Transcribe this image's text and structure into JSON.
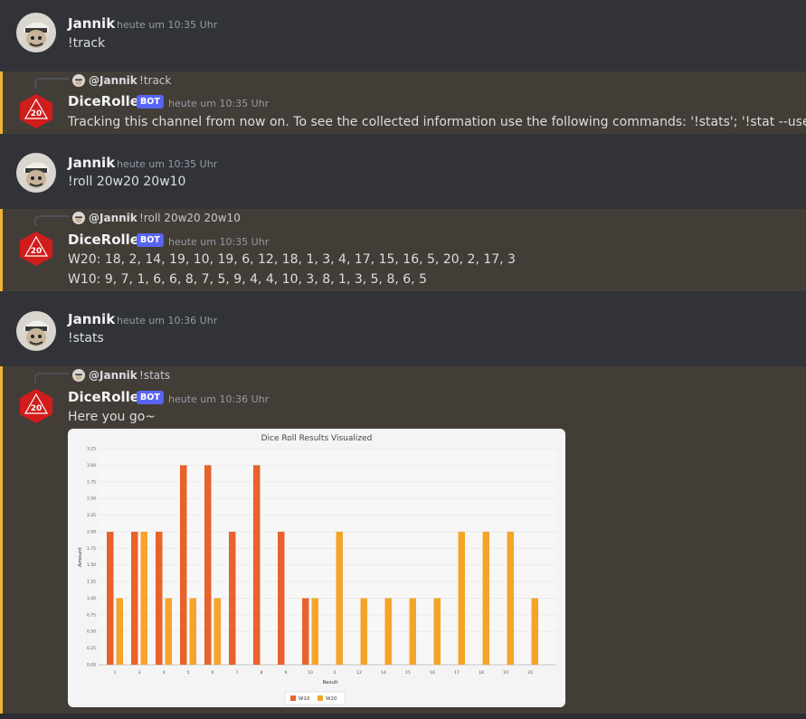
{
  "messages": [
    {
      "author": "Jannik",
      "timestamp": "heute um 10:35 Uhr",
      "text": "!track"
    },
    {
      "reply_author": "@Jannik",
      "reply_text": "!track",
      "author": "DiceRoller",
      "badge": "BOT",
      "timestamp": "heute um 10:35 Uhr",
      "text": "Tracking this channel from now on. To see the collected information use the following commands: '!stats'; '!stat --user'"
    },
    {
      "author": "Jannik",
      "timestamp": "heute um 10:35 Uhr",
      "text": "!roll 20w20 20w10"
    },
    {
      "reply_author": "@Jannik",
      "reply_text": "!roll 20w20 20w10",
      "author": "DiceRoller",
      "badge": "BOT",
      "timestamp": "heute um 10:35 Uhr",
      "line1": "W20: 18, 2, 14, 19, 10, 19, 6, 12, 18, 1, 3, 4, 17, 15, 16, 5, 20, 2, 17, 3",
      "line2": "W10: 9, 7, 1, 6, 6, 8, 7, 5, 9, 4, 4, 10, 3, 8, 1, 3, 5, 8, 6, 5"
    },
    {
      "author": "Jannik",
      "timestamp": "heute um 10:36 Uhr",
      "text": "!stats"
    },
    {
      "reply_author": "@Jannik",
      "reply_text": "!stats",
      "author": "DiceRoller",
      "badge": "BOT",
      "timestamp": "heute um 10:36 Uhr",
      "text": "Here you go~"
    }
  ],
  "icons": {
    "user_avatar": "user-avatar-icon",
    "bot_avatar": "d20-icon"
  },
  "colors": {
    "w10": "#e8622c",
    "w20": "#f5a42a",
    "mention_bg": "#433d37",
    "mention_bar": "#f0b232",
    "badge": "#5865f2"
  },
  "chart_data": {
    "type": "bar",
    "title": "Dice Roll Results Visualized",
    "xlabel": "Result",
    "ylabel": "Amount",
    "ylim": [
      0,
      3.25
    ],
    "yticks": [
      "0.00",
      "0.25",
      "0.50",
      "0.75",
      "1.00",
      "1.25",
      "1.50",
      "1.75",
      "2.00",
      "2.25",
      "2.50",
      "2.75",
      "3.00",
      "3.25"
    ],
    "categories": [
      "1",
      "3",
      "4",
      "5",
      "6",
      "7",
      "8",
      "9",
      "10",
      "2",
      "12",
      "14",
      "15",
      "16",
      "17",
      "18",
      "19",
      "20"
    ],
    "series": [
      {
        "name": "W10",
        "values": [
          2,
          2,
          2,
          3,
          3,
          2,
          3,
          2,
          1,
          0,
          0,
          0,
          0,
          0,
          0,
          0,
          0,
          0
        ]
      },
      {
        "name": "W20",
        "values": [
          1,
          2,
          1,
          1,
          1,
          0,
          0,
          0,
          1,
          2,
          1,
          1,
          1,
          1,
          2,
          2,
          2,
          1
        ]
      }
    ],
    "legend": "bottom",
    "grid": true
  }
}
